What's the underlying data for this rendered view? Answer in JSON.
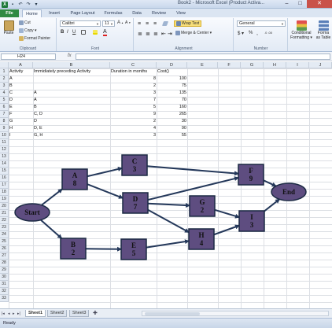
{
  "window": {
    "title": "Book2 - Microsoft Excel (Product Activa...",
    "controls": [
      "–",
      "□",
      "✕"
    ]
  },
  "ribbon_tabs": [
    "File",
    "Home",
    "Insert",
    "Page Layout",
    "Formulas",
    "Data",
    "Review",
    "View"
  ],
  "ribbon": {
    "clipboard": {
      "label": "Clipboard",
      "paste": "Paste",
      "cut": "Cut",
      "copy": "Copy ▾",
      "format_painter": "Format Painter"
    },
    "font": {
      "label": "Font",
      "name": "Calibri",
      "size": "11",
      "bold": "B",
      "italic": "I",
      "underline": "U"
    },
    "alignment": {
      "label": "Alignment",
      "wrap_text": "Wrap Text",
      "merge_center": "Merge & Center ▾"
    },
    "number": {
      "label": "Number",
      "format": "General",
      "currency": "$ ▾",
      "percent": "%",
      "comma": ","
    },
    "styles": {
      "conditional": "Conditional",
      "conditional2": "Formatting ▾",
      "format_as": "Forma",
      "format_as2": "as Table"
    }
  },
  "formula_bar": {
    "name_box": "H24",
    "fx": "fx",
    "formula": ""
  },
  "columns": [
    "A",
    "B",
    "C",
    "D",
    "E",
    "F",
    "G",
    "H",
    "I",
    "J"
  ],
  "rows": [
    "1",
    "2",
    "3",
    "4",
    "5",
    "6",
    "7",
    "8",
    "9",
    "10",
    "11",
    "12",
    "13",
    "14",
    "15",
    "16",
    "17",
    "18",
    "19",
    "20",
    "21",
    "22",
    "23",
    "24",
    "25",
    "26",
    "27",
    "28",
    "29",
    "30",
    "31",
    "32",
    "33"
  ],
  "table": {
    "headers": [
      "Activity",
      "Immidiately preceding Activity",
      "Duration in months",
      "Cost()"
    ],
    "rows": [
      [
        "A",
        "",
        "8",
        "100"
      ],
      [
        "B",
        "",
        "2",
        "75"
      ],
      [
        "C",
        "A",
        "3",
        "135"
      ],
      [
        "D",
        "A",
        "7",
        "70"
      ],
      [
        "E",
        "B",
        "5",
        "160"
      ],
      [
        "F",
        "C, D",
        "9",
        "265"
      ],
      [
        "G",
        "D",
        "2",
        "30"
      ],
      [
        "H",
        "D, E",
        "4",
        "90"
      ],
      [
        "I",
        "G, H",
        "3",
        "55"
      ]
    ]
  },
  "diagram": {
    "start": "Start",
    "end": "End",
    "nodes": [
      {
        "id": "A",
        "label": "A",
        "dur": "8"
      },
      {
        "id": "B",
        "label": "B",
        "dur": "2"
      },
      {
        "id": "C",
        "label": "C",
        "dur": "3"
      },
      {
        "id": "D",
        "label": "D",
        "dur": "7"
      },
      {
        "id": "E",
        "label": "E",
        "dur": "5"
      },
      {
        "id": "F",
        "label": "F",
        "dur": "9"
      },
      {
        "id": "G",
        "label": "G",
        "dur": "2"
      },
      {
        "id": "H",
        "label": "H",
        "dur": "4"
      },
      {
        "id": "I",
        "label": "I",
        "dur": "3"
      }
    ],
    "colors": {
      "fill": "#5e4d80",
      "stroke": "#1c2a44",
      "arrow": "#24385a"
    }
  },
  "sheets": [
    "Sheet1",
    "Sheet2",
    "Sheet3"
  ],
  "status": "Ready"
}
